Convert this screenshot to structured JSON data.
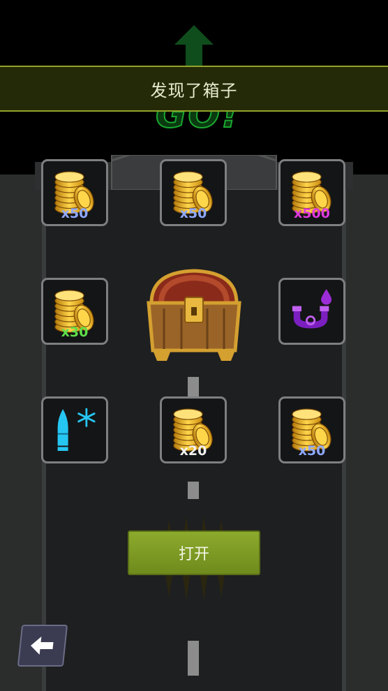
{
  "banner": {
    "title": "发现了箱子"
  },
  "background": {
    "go_text": "GO!"
  },
  "rewards": [
    {
      "icon": "gold-coins-icon",
      "quantity": "x50",
      "color": "#8fa8ff"
    },
    {
      "icon": "gold-coins-icon",
      "quantity": "x50",
      "color": "#8fa8ff"
    },
    {
      "icon": "gold-coins-icon",
      "quantity": "x500",
      "color": "#e03adf"
    },
    {
      "icon": "gold-coins-icon",
      "quantity": "x30",
      "color": "#5ee04a"
    },
    {
      "icon": "purple-magnet-drop-icon",
      "quantity": "",
      "color": "#9b2cd6"
    },
    {
      "icon": "ice-bullet-icon",
      "quantity": "",
      "color": "#26c6f2"
    },
    {
      "icon": "gold-coins-icon",
      "quantity": "x20",
      "color": "#f2f2f2"
    },
    {
      "icon": "gold-coins-icon",
      "quantity": "x50",
      "color": "#8fa8ff"
    }
  ],
  "center_item": {
    "icon": "treasure-chest-icon"
  },
  "open_button": {
    "label": "打开"
  },
  "back_button": {
    "icon": "back-arrow-icon"
  }
}
